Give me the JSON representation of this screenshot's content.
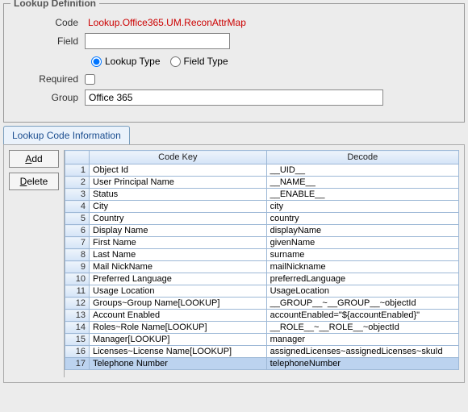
{
  "fieldset": {
    "legend": "Lookup Definition",
    "code_label": "Code",
    "code_value": "Lookup.Office365.UM.ReconAttrMap",
    "field_label": "Field",
    "field_value": "",
    "lookup_type_label": "Lookup Type",
    "field_type_label": "Field Type",
    "type_selected": "lookup",
    "required_label": "Required",
    "required_checked": false,
    "group_label": "Group",
    "group_value": "Office 365"
  },
  "tab": {
    "label": "Lookup Code Information"
  },
  "buttons": {
    "add": "Add",
    "delete": "Delete"
  },
  "table": {
    "col_key": "Code Key",
    "col_decode": "Decode",
    "selected_index": 16,
    "rows": [
      {
        "n": "1",
        "key": "Object Id",
        "decode": "__UID__"
      },
      {
        "n": "2",
        "key": "User Principal Name",
        "decode": "__NAME__"
      },
      {
        "n": "3",
        "key": "Status",
        "decode": "__ENABLE__"
      },
      {
        "n": "4",
        "key": "City",
        "decode": "city"
      },
      {
        "n": "5",
        "key": "Country",
        "decode": "country"
      },
      {
        "n": "6",
        "key": "Display Name",
        "decode": "displayName"
      },
      {
        "n": "7",
        "key": "First Name",
        "decode": "givenName"
      },
      {
        "n": "8",
        "key": "Last Name",
        "decode": "surname"
      },
      {
        "n": "9",
        "key": "Mail NickName",
        "decode": "mailNickname"
      },
      {
        "n": "10",
        "key": "Preferred Language",
        "decode": "preferredLanguage"
      },
      {
        "n": "11",
        "key": "Usage Location",
        "decode": "UsageLocation"
      },
      {
        "n": "12",
        "key": "Groups~Group Name[LOOKUP]",
        "decode": "__GROUP__~__GROUP__~objectId"
      },
      {
        "n": "13",
        "key": "Account Enabled",
        "decode": "accountEnabled=\"${accountEnabled}\""
      },
      {
        "n": "14",
        "key": "Roles~Role Name[LOOKUP]",
        "decode": "__ROLE__~__ROLE__~objectId"
      },
      {
        "n": "15",
        "key": "Manager[LOOKUP]",
        "decode": "manager"
      },
      {
        "n": "16",
        "key": "Licenses~License Name[LOOKUP]",
        "decode": "assignedLicenses~assignedLicenses~skuId"
      },
      {
        "n": "17",
        "key": "Telephone Number",
        "decode": "telephoneNumber"
      }
    ]
  }
}
